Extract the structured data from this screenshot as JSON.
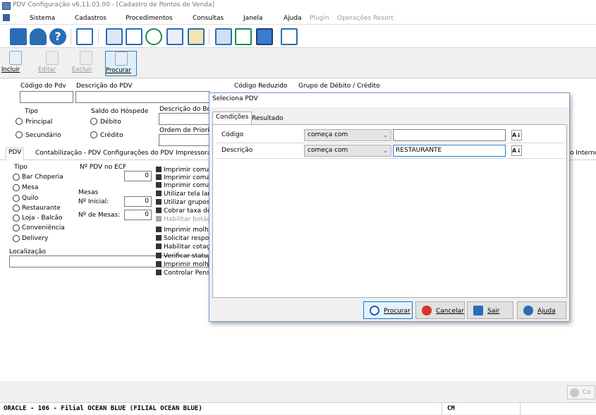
{
  "window": {
    "title": "PDV Configuração v6.11.03.00 - [Cadastro de Pontos de Venda]"
  },
  "menu": {
    "items": [
      "Sistema",
      "Cadastros",
      "Procedimentos",
      "Consultas",
      "Janela",
      "Ajuda",
      "Plugin",
      "Operações Resort"
    ],
    "disabled": [
      "Plugin",
      "Operações Resort"
    ]
  },
  "toolbar_icons": [
    "exit-icon",
    "users-icon",
    "help-icon",
    "network-icon",
    "print-icon",
    "mail-icon",
    "refresh-icon",
    "report-icon",
    "report-edit-icon",
    "calculator-icon",
    "send-mail-icon",
    "monitor-info-icon",
    "card-icon"
  ],
  "record_toolbar": {
    "incluir": "Incluir",
    "editar": "Editar",
    "excluir": "Excluir",
    "procurar": "Procurar"
  },
  "form": {
    "codigo_pdv_label": "Código do Pdv",
    "descricao_label": "Descrição do PDV",
    "codigo_reduzido_label": "Código Reduzido",
    "grupo_label": "Grupo de Débito / Crédito",
    "tipo_label": "Tipo",
    "tipo_principal": "Principal",
    "tipo_secundario": "Secundário",
    "saldo_label": "Saldo do Hóspede",
    "saldo_debito": "Débito",
    "saldo_credito": "Crédito",
    "descricao_botao_label": "Descrição do Bot",
    "ordem_label": "Ordem de Priorid"
  },
  "tabs": [
    "PDV",
    "Contabilização - PDV",
    "Configurações do PDV",
    "Impressoras"
  ],
  "tab_right_fragment": "o Interno",
  "pdv_tab": {
    "tipo_label": "Tipo",
    "tipos": [
      "Bar Choperia",
      "Mesa",
      "Quilo",
      "Restaurante",
      "Loja - Balcão",
      "Conveniência",
      "Delivery"
    ],
    "ecf_label": "Nº PDV no ECF",
    "ecf_value": "0",
    "mesas_label": "Mesas",
    "inicial_label": "Nº Inicial:",
    "inicial_value": "0",
    "num_mesas_label": "Nº de Mesas:",
    "num_mesas_value": "0",
    "localizacao_label": "Localização",
    "options": [
      "Imprimir comar",
      "Imprimir comar",
      "Imprimir comar",
      "Utilizar tela lanc",
      "Utilizar grupos",
      "Cobrar taxa de",
      "Habilitar botão",
      "Imprimir molho,",
      "Solicitar respon",
      "Habilitar cotaçã",
      "Verificar status",
      "Imprimir molho,",
      "Controlar Pensã"
    ],
    "disabled_option": "Habilitar botão"
  },
  "confirm_fragment": "Co",
  "status": {
    "left": "ORACLE - 106 - Filial OCEAN BLUE (FILIAL OCEAN BLUE)",
    "right": "CM"
  },
  "dialog": {
    "title": "Seleciona PDV",
    "tabs": [
      "Condições",
      "Resultado"
    ],
    "rows": [
      {
        "field": "Código",
        "operator": "começa com",
        "value": ""
      },
      {
        "field": "Descrição",
        "operator": "começa com",
        "value": "RESTAURANTE"
      }
    ],
    "buttons": {
      "procurar": "Procurar",
      "cancelar": "Cancelar",
      "sair": "Sair",
      "ajuda": "Ajuda"
    }
  },
  "colors": {
    "accent": "#0078d7",
    "toolbar_blue": "#2a6db5",
    "cancel_red": "#d9342b"
  }
}
